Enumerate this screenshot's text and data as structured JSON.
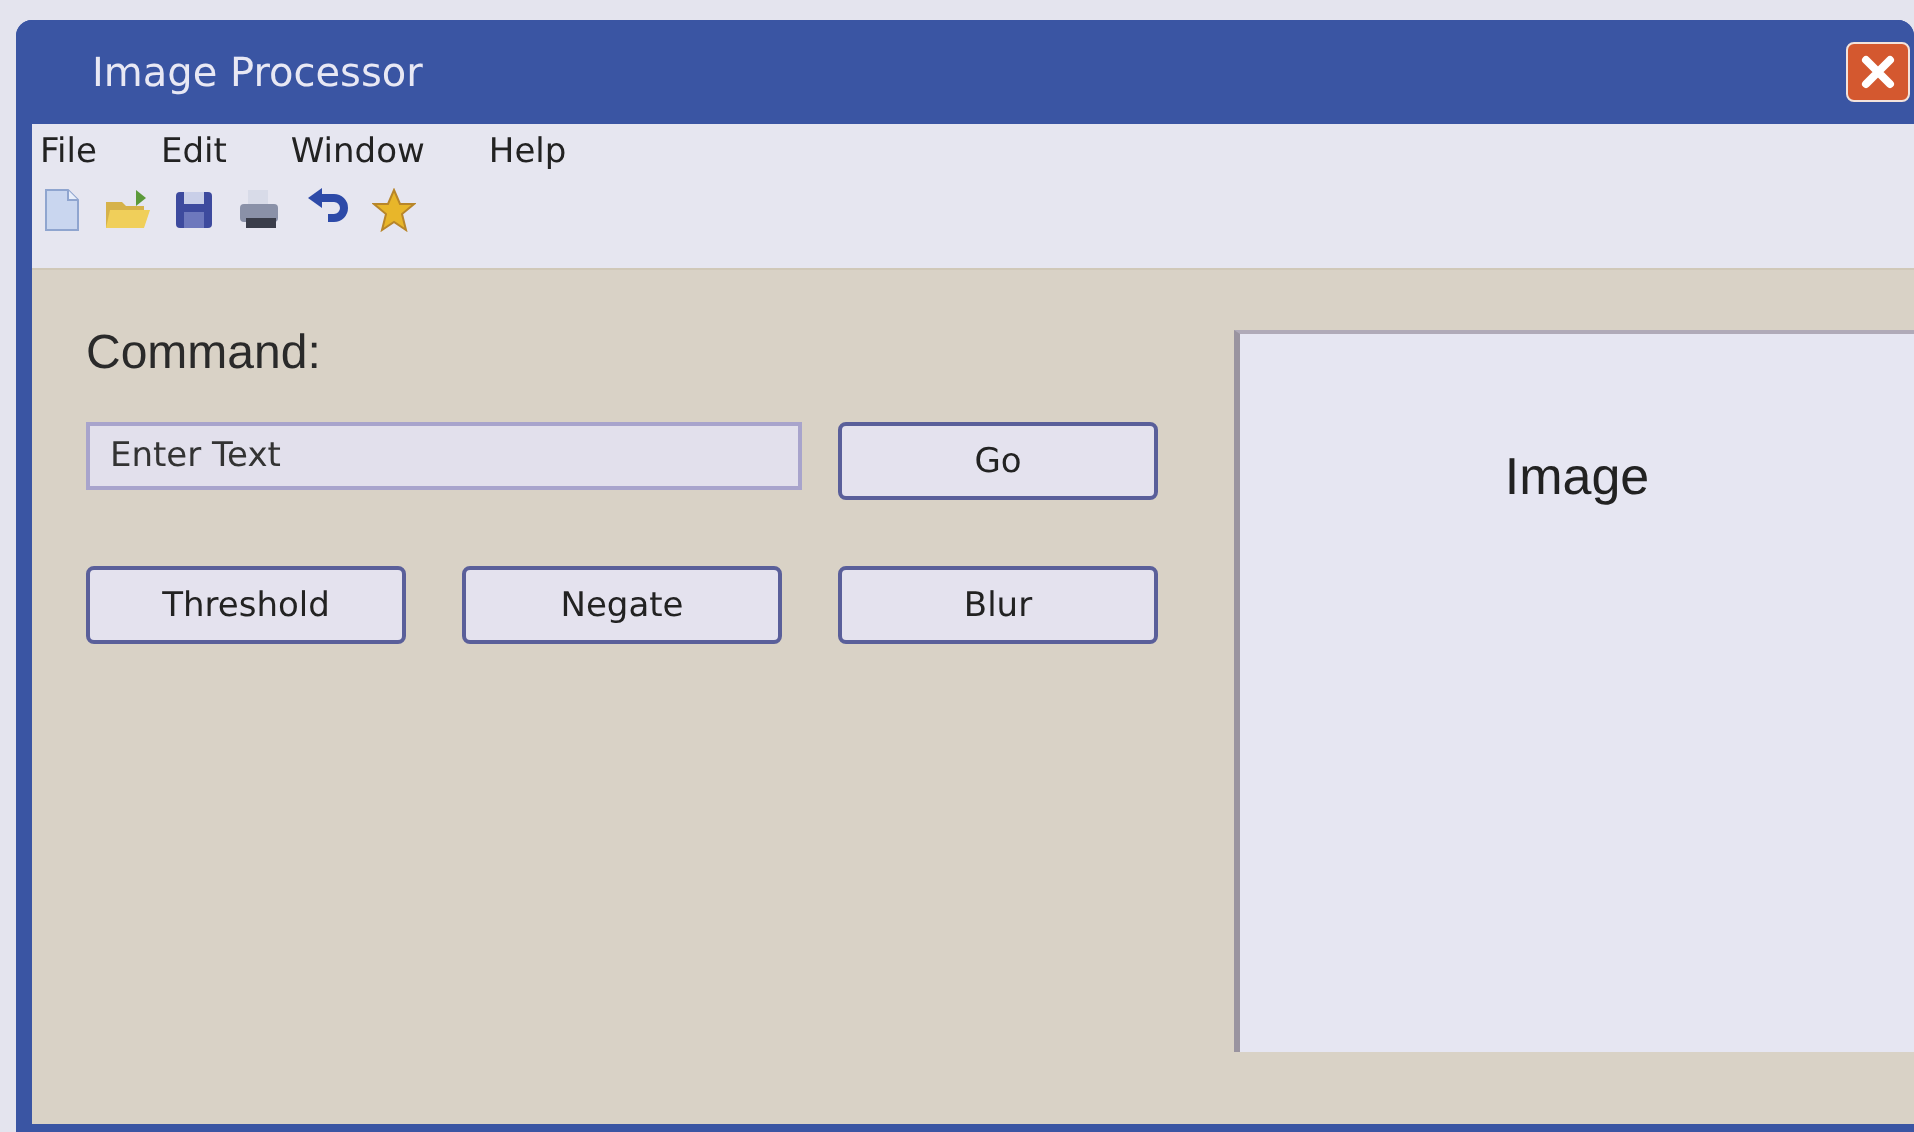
{
  "window": {
    "title": "Image Processor"
  },
  "menu": [
    "File",
    "Edit",
    "Window",
    "Help"
  ],
  "command": {
    "label": "Command:",
    "placeholder": "Enter Text",
    "go": "Go"
  },
  "actions": [
    "Threshold",
    "Negate",
    "Blur"
  ],
  "image_panel": {
    "label": "Image"
  }
}
